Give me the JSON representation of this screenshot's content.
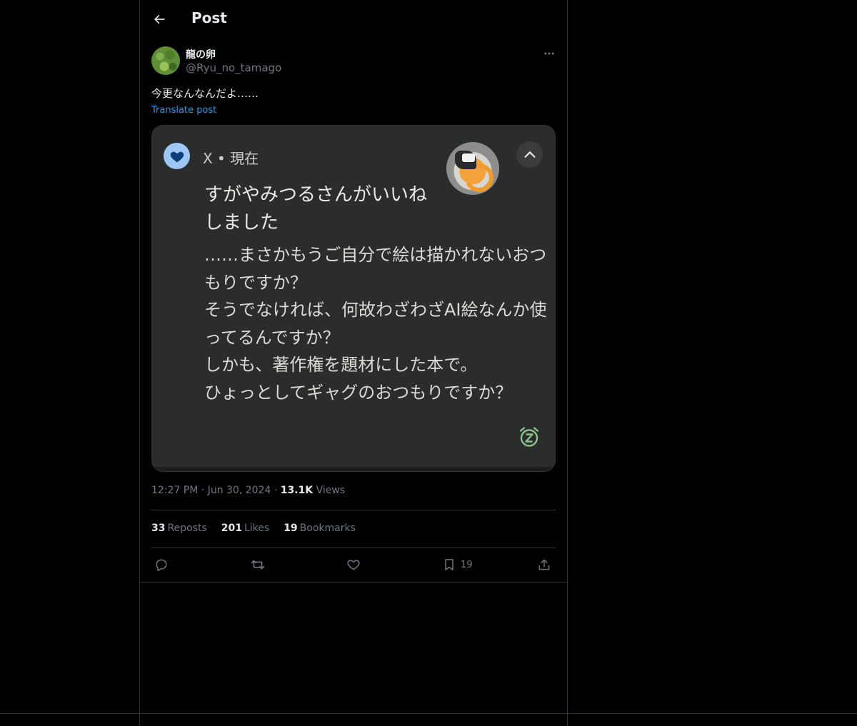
{
  "header": {
    "title": "Post"
  },
  "author": {
    "display_name": "龍の卵",
    "handle": "@Ryu_no_tamago"
  },
  "post": {
    "text": "今更なんなんだよ……",
    "translate_label": "Translate post",
    "embedded_image": {
      "source_label": "X • 現在",
      "title_line1": "すがやみつるさんがいいね",
      "title_line2": "しました",
      "body_lines": [
        "……まさかもうご自分で絵は描かれないおつ",
        "もりですか？",
        "そうでなければ、何故わざわざAI絵なんか使",
        "ってるんですか？",
        "しかも、著作権を題材にした本で。",
        "ひょっとしてギャグのおつもりですか？"
      ]
    }
  },
  "meta": {
    "time": "12:27 PM",
    "date": "Jun 30, 2024",
    "views_count": "13.1K",
    "views_label": "Views",
    "separator": "·"
  },
  "stats": {
    "reposts": {
      "count": "33",
      "label": "Reposts"
    },
    "likes": {
      "count": "201",
      "label": "Likes"
    },
    "bookmarks": {
      "count": "19",
      "label": "Bookmarks"
    }
  },
  "actions": {
    "bookmark_count": "19"
  },
  "icons": {
    "back": "arrow-left-icon",
    "more": "more-horizontal-icon",
    "heart": "heart-icon",
    "collapse": "chevron-up-icon",
    "snooze": "snooze-alarm-icon",
    "reply": "reply-icon",
    "repost": "repost-icon",
    "like": "heart-outline-icon",
    "bookmark": "bookmark-icon",
    "share": "share-icon"
  },
  "colors": {
    "accent": "#1d9bf0",
    "background": "#000000",
    "border": "#2f3336",
    "muted_text": "#71767b"
  }
}
